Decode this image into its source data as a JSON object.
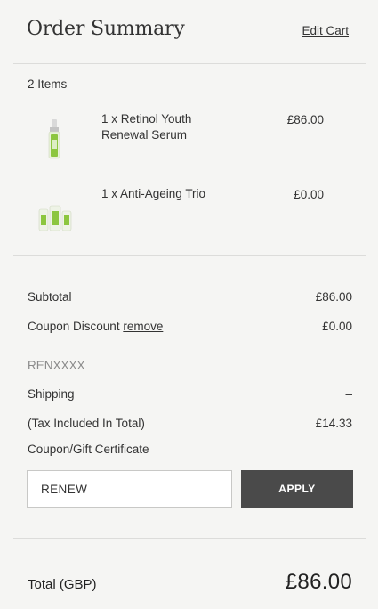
{
  "header": {
    "title": "Order Summary",
    "edit_cart": "Edit Cart"
  },
  "cart": {
    "items_count": "2 Items",
    "items": [
      {
        "name": "1 x Retinol Youth Renewal Serum",
        "price": "£86.00",
        "icon": "serum-bottle-icon"
      },
      {
        "name": "1 x Anti-Ageing Trio",
        "price": "£0.00",
        "icon": "skincare-trio-icon"
      }
    ]
  },
  "summary": {
    "subtotal_label": "Subtotal",
    "subtotal_value": "£86.00",
    "coupon_label": "Coupon Discount",
    "coupon_remove": "remove",
    "coupon_value": "£0.00",
    "coupon_code": "RENXXXX",
    "shipping_label": "Shipping",
    "shipping_value": "–",
    "tax_label": "(Tax Included In Total)",
    "tax_value": "£14.33",
    "gift_label": "Coupon/Gift Certificate"
  },
  "coupon_form": {
    "input_value": "RENEW",
    "apply_label": "APPLY"
  },
  "total": {
    "label": "Total (GBP)",
    "value": "£86.00"
  },
  "colors": {
    "background": "#f5f5f3",
    "button": "#4a4a4a",
    "accent_green": "#8cc63f"
  }
}
